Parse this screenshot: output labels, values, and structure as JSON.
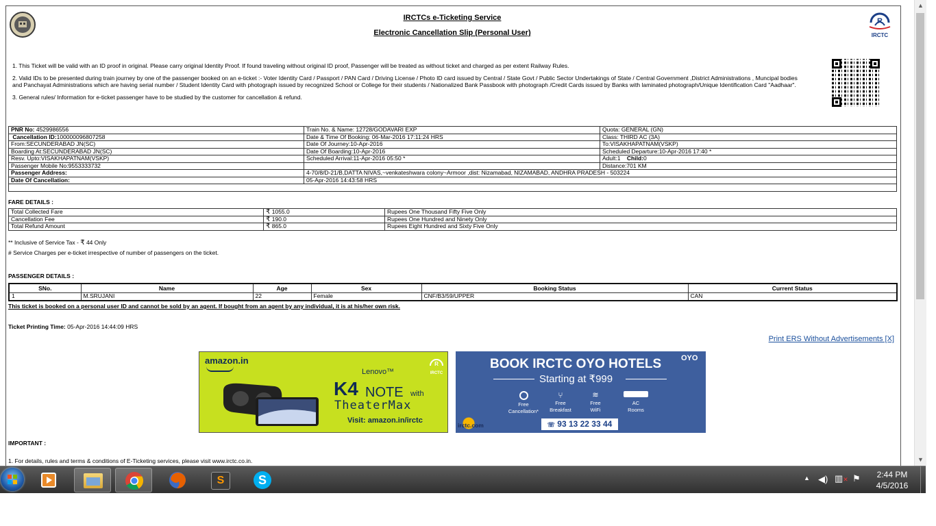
{
  "header": {
    "title": "IRCTCs e-Ticketing Service",
    "subtitle": "Electronic Cancellation Slip (Personal User)",
    "irctc_logo_text": "IRCTC"
  },
  "rules": [
    "1. This Ticket will be valid with an ID proof in original. Please carry original Identity Proof. If found traveling without original ID proof, Passenger will be treated as without ticket and charged as per extent Railway Rules.",
    "2. Valid IDs to be presented during train journey by one of the passenger booked on an e-ticket :- Voter Identity Card / Passport / PAN Card / Driving License / Photo ID card issued by Central / State Govt / Public Sector Undertakings of State / Central Government ,District Administrations , Muncipal bodies and Panchayat Administrations which are having serial number / Student Identity Card with photograph issued by recognized School or College for their students / Nationalized Bank Passbook with photograph /Credit Cards issued by Banks with laminated photograph/Unique Identification Card \"Aadhaar\".",
    "3. General rules/ Information for e-ticket passenger have to be studied by the customer for cancellation & refund."
  ],
  "ticket": {
    "pnr_label": "PNR No:",
    "pnr": " 4529986556",
    "train": "Train No. & Name: 12728/GODAVARI EXP",
    "quota": "Quota: GENERAL (GN)",
    "cancel_id_label": "Cancellation ID:",
    "cancel_id": "100000096807258",
    "booking_time": "Date & Time Of Booking:  06-Mar-2016 17:11:24 HRS",
    "class": "Class: THIRD AC (3A)",
    "from": "From:SECUNDERABAD JN(SC)",
    "journey_date": "Date Of Journey:10-Apr-2016",
    "to": "To:VISAKHAPATNAM(VSKP)",
    "boarding_at": "Boarding At:SECUNDERABAD JN(SC)",
    "boarding_date": "Date Of Boarding:10-Apr-2016",
    "sched_departure": "Scheduled Departure:10-Apr-2016 17:40 *",
    "resv_upto": "Resv. Upto:VISAKHAPATNAM(VSKP)",
    "sched_arrival": "Scheduled Arrival:11-Apr-2016 05:50 *",
    "adult": "Adult:1",
    "child_label": "Child:",
    "child": "0",
    "mobile": "Passenger Mobile No:9553333732",
    "distance": "Distance:701 KM",
    "address_label": "Passenger Address:",
    "address": "4-70/8/D-21/B,DATTA NIVAS,~venkateshwara colony~Armoor ,dist: Nizamabad, NIZAMABAD, ANDHRA PRADESH - 503224",
    "cancel_date_label": "Date Of Cancellation:",
    "cancel_date": "05-Apr-2016 14:43:58 HRS"
  },
  "fare": {
    "heading": "FARE DETAILS :",
    "rupee": "₹",
    "rows": [
      {
        "label": "Total Collected Fare",
        "amount": "1055.0",
        "words": "Rupees One Thousand Fifty Five Only"
      },
      {
        "label": "Cancellation Fee",
        "amount": "190.0",
        "words": "Rupees One Hundred and Ninety Only"
      },
      {
        "label": "Total Refund Amount",
        "amount": "865.0",
        "words": "Rupees Eight Hundred and Sixty Five Only"
      }
    ],
    "note1_prefix": "** Inclusive of Service Tax - ",
    "note1_amount": " 44 Only",
    "note2": "# Service Charges per e-ticket irrespective of number of passengers on the ticket."
  },
  "passengers": {
    "heading": "PASSENGER DETAILS :",
    "columns": [
      "SNo.",
      "Name",
      "Age",
      "Sex",
      "Booking Status",
      "Current Status"
    ],
    "rows": [
      [
        "1",
        "M.SRUJANI",
        "22",
        "Female",
        "CNF/B3/59/UPPER",
        "CAN"
      ]
    ],
    "warning": "This ticket is booked on a personal user ID and cannot be sold by an agent. If bought from an agent by any individual, it is at his/her own risk."
  },
  "printing": {
    "label": "Ticket Printing Time:",
    "value": " 05-Apr-2016 14:44:09 HRS"
  },
  "print_link": "Print ERS Without Advertisements [X]",
  "ad_amazon": {
    "brand": "amazon.in",
    "lenovo": "Lenovo™",
    "model": "K4",
    "note": "NOTE",
    "with": "with",
    "theater": "TheaterMax",
    "visit": "Visit: amazon.in/irctc",
    "badge": "IRCTC",
    "colors": {
      "bg": "#c7e01f",
      "dark": "#0f2a55"
    }
  },
  "ad_oyo": {
    "headline": "BOOK IRCTC OYO HOTELS",
    "oyo": "OYO",
    "starting": "Starting at ₹999",
    "features": [
      {
        "icon": "cancel-icon",
        "label": "Free\nCancellation*"
      },
      {
        "icon": "breakfast-icon",
        "label": "Free\nBreakfast"
      },
      {
        "icon": "wifi-icon",
        "label": "Free\nWiFi"
      },
      {
        "icon": "ac-icon",
        "label": "AC\nRooms"
      }
    ],
    "phone": "93 13 22 33 44",
    "footer": "irctc.com",
    "colors": {
      "bg": "#3e5f9e"
    }
  },
  "important": {
    "heading": "IMPORTANT :",
    "line1": "1. For details, rules and terms & conditions of E-Ticketing services, please visit www.irctc.co.in."
  },
  "taskbar": {
    "apps": [
      "start-orb-icon",
      "media-player-icon",
      "file-explorer-icon",
      "chrome-icon",
      "firefox-icon",
      "sublime-text-icon",
      "skype-icon"
    ],
    "time": "2:44 PM",
    "date": "4/5/2016"
  }
}
